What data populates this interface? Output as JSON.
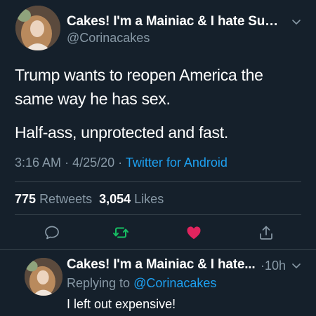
{
  "main_tweet": {
    "author_name": "Cakes! I'm a Mainiac & I hate Susa...",
    "author_handle": "@Corinacakes",
    "text_paragraphs": [
      "Trump wants to reopen America the same way he has sex.",
      "Half-ass, unprotected and fast."
    ],
    "time": "3:16 AM",
    "date": "4/25/20",
    "dot": "·",
    "source": "Twitter for Android",
    "retweets_count": "775",
    "retweets_label": "Retweets",
    "likes_count": "3,054",
    "likes_label": "Likes",
    "actions": [
      "reply-icon",
      "retweet-icon",
      "like-icon",
      "share-icon"
    ]
  },
  "reply_tweet": {
    "author_name": "Cakes! I'm a Mainiac & I hate...",
    "time": "·10h",
    "replying_label": "Replying to",
    "replying_handle": "@Corinacakes",
    "text": "I left out expensive!"
  },
  "colors": {
    "background": "#15202b",
    "secondary_text": "#8899a6",
    "link": "#1da1f2",
    "retweet_green": "#17bf63",
    "like_red": "#e0245e",
    "divider": "#38444d"
  }
}
